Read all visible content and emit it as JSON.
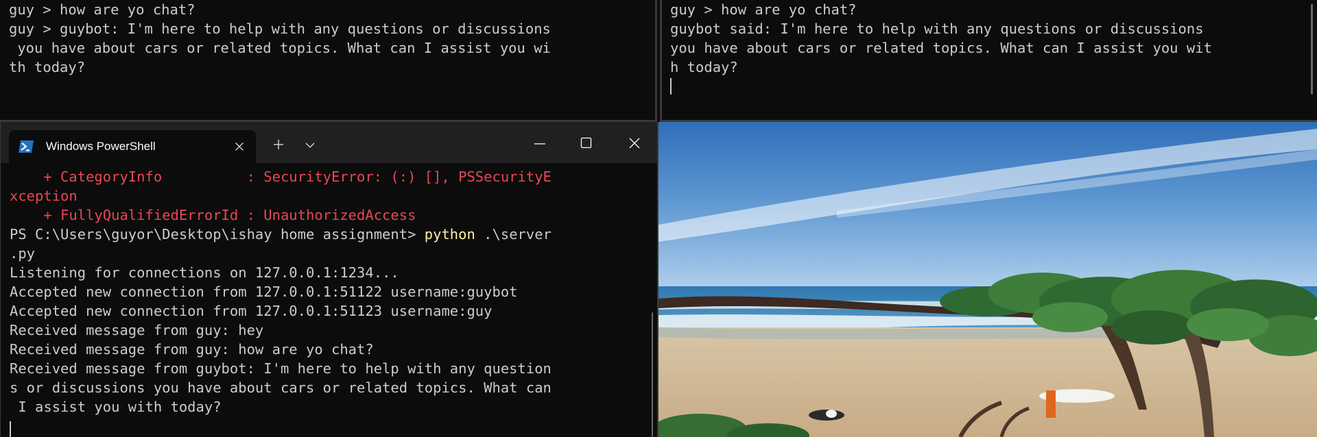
{
  "top_left_console": {
    "lines": [
      "guy > how are yo chat?",
      "guy > guybot: I'm here to help with any questions or discussions",
      " you have about cars or related topics. What can I assist you wi",
      "th today?"
    ]
  },
  "top_right_console": {
    "lines": [
      "guy > how are yo chat?",
      "guybot said: I'm here to help with any questions or discussions",
      "you have about cars or related topics. What can I assist you wit",
      "h today?"
    ]
  },
  "powershell": {
    "tab_title": "Windows PowerShell",
    "icons": {
      "tab": "powershell-icon",
      "tab_close": "close-icon",
      "new_tab": "plus-icon",
      "dropdown": "chevron-down-icon",
      "minimize": "minimize-icon",
      "maximize": "maximize-icon",
      "close": "close-icon"
    },
    "lines": [
      "    + CategoryInfo          : SecurityError: (:) [], PSSecurityE",
      "xception",
      "    + FullyQualifiedErrorId : UnauthorizedAccess",
      "PS C:\\Users\\guyor\\Desktop\\ishay home assignment> ",
      ".py",
      "Listening for connections on 127.0.0.1:1234...",
      "Accepted new connection from 127.0.0.1:51122 username:guybot",
      "Accepted new connection from 127.0.0.1:51123 username:guy",
      "Received message from guy: hey",
      "Received message from guy: how are yo chat?",
      "Received message from guybot: I'm here to help with any question",
      "s or discussions you have about cars or related topics. What can",
      " I assist you with today?"
    ],
    "command_word": "python",
    "command_args": " .\\server"
  },
  "colors": {
    "terminal_bg": "#0c0c0c",
    "terminal_fg": "#cccccc",
    "error_red": "#e74856",
    "command_yellow": "#f9f1a5",
    "titlebar_bg": "#202020",
    "powershell_blue": "#2671be"
  }
}
